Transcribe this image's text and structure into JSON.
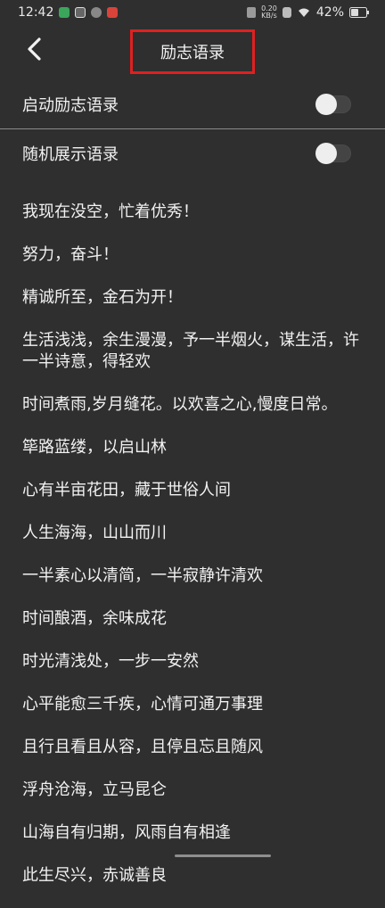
{
  "status": {
    "time": "12:42",
    "net_speed": "0.20\nKB/s",
    "battery": "42%"
  },
  "header": {
    "title": "励志语录",
    "back_icon": "chevron-left-icon"
  },
  "settings": [
    {
      "label": "启动励志语录",
      "enabled": false
    },
    {
      "label": "随机展示语录",
      "enabled": false
    }
  ],
  "quotes": [
    "我现在没空，忙着优秀！",
    "努力，奋斗！",
    "精诚所至，金石为开！",
    "生活浅浅，余生漫漫，予一半烟火，谋生活，许一半诗意，得轻欢",
    "时间煮雨,岁月缝花。以欢喜之心,慢度日常。",
    "筚路蓝缕，以启山林",
    "心有半亩花田，藏于世俗人间",
    "人生海海，山山而川",
    "一半素心以清简，一半寂静许清欢",
    "时间酿酒，余味成花",
    "时光清浅处，一步一安然",
    "心平能愈三千疾，心情可通万事理",
    "且行且看且从容，且停且忘且随风",
    "浮舟沧海，立马昆仑",
    "山海自有归期，风雨自有相逢",
    "此生尽兴，赤诚善良"
  ],
  "colors": {
    "background": "#2f2f2f",
    "highlight": "#e02020"
  }
}
